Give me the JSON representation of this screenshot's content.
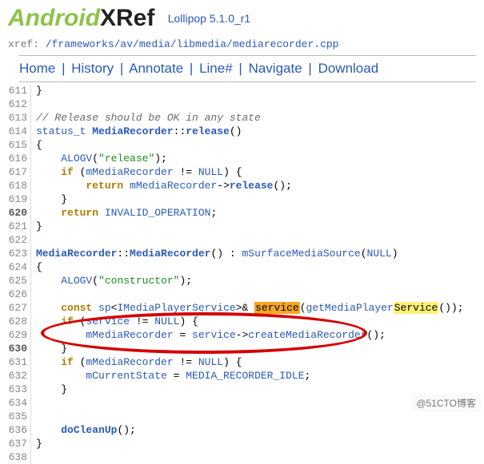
{
  "header": {
    "logo_and": "Android",
    "logo_x": "XRef",
    "version": "Lollipop 5.1.0_r1"
  },
  "xref": {
    "label": "xref: ",
    "path": "/frameworks/av/media/libmedia/mediarecorder.cpp"
  },
  "nav": {
    "home": "Home",
    "history": "History",
    "annotate": "Annotate",
    "linenum": "Line#",
    "navigate": "Navigate",
    "download": "Download"
  },
  "lines": {
    "start": 611,
    "end": 638,
    "bold": [
      620,
      630
    ]
  },
  "code": {
    "l611": "}",
    "l612": "",
    "l613_cmt": "// Release should be OK in any state",
    "l614_type": "status_t",
    "l614_cls": "MediaRecorder",
    "l614_func": "release",
    "l615": "{",
    "l616_fn": "ALOGV",
    "l616_str": "\"release\"",
    "l617_kw": "if",
    "l617_id": "mMediaRecorder",
    "l617_null": "NULL",
    "l618_kw": "return",
    "l618_id": "mMediaRecorder",
    "l618_call": "release",
    "l619": "    }",
    "l620_kw": "return",
    "l620_id": "INVALID_OPERATION",
    "l621": "}",
    "l622": "",
    "l623_cls1": "MediaRecorder",
    "l623_cls2": "MediaRecorder",
    "l623_id": "mSurfaceMediaSource",
    "l623_null": "NULL",
    "l624": "{",
    "l625_fn": "ALOGV",
    "l625_str": "\"constructor\"",
    "l626": "",
    "l627_kw": "const",
    "l627_sp": "sp",
    "l627_t": "IMediaPlayerService",
    "l627_svc": "service",
    "l627_get": "getMediaPlayer",
    "l627_svc2": "Service",
    "l628_kw": "if",
    "l628_id": "service",
    "l628_null": "NULL",
    "l629_lhs": "mMediaRecorder",
    "l629_rhs": "service",
    "l629_call": "createMediaRecorder",
    "l630": "    }",
    "l631_kw": "if",
    "l631_id": "mMediaRecorder",
    "l631_null": "NULL",
    "l632_lhs": "mCurrentState",
    "l632_rhs": "MEDIA_RECORDER_IDLE",
    "l633": "    }",
    "l634": "",
    "l635": "",
    "l636_fn": "doCleanUp",
    "l637": "}"
  },
  "watermark": "@51CTO博客"
}
